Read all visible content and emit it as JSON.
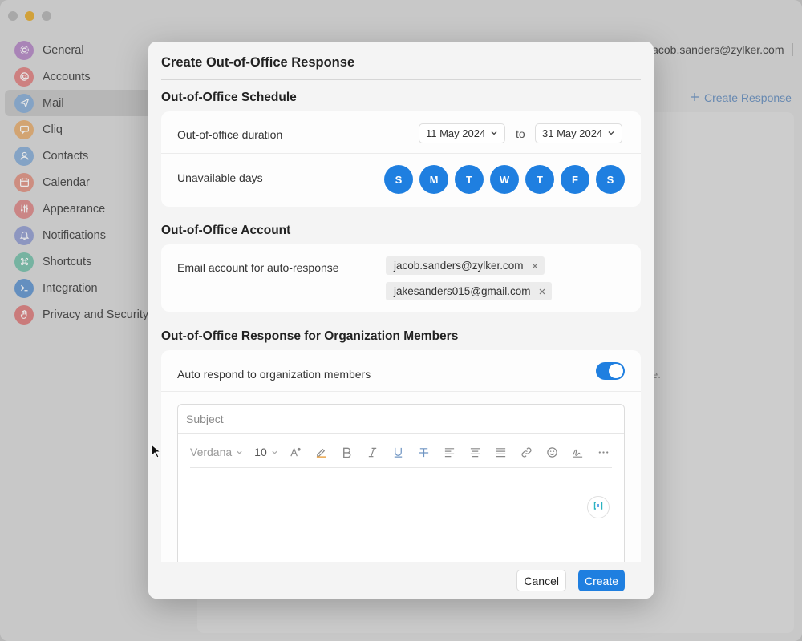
{
  "sidebar": {
    "items": [
      {
        "label": "General",
        "icon": "gear-icon",
        "color": "#b98fc9"
      },
      {
        "label": "Accounts",
        "icon": "at-icon",
        "color": "#e28a8a"
      },
      {
        "label": "Mail",
        "icon": "send-icon",
        "color": "#8fb2d9",
        "active": true
      },
      {
        "label": "Cliq",
        "icon": "chat-icon",
        "color": "#e7b37a"
      },
      {
        "label": "Contacts",
        "icon": "contact-icon",
        "color": "#8fb2d9"
      },
      {
        "label": "Calendar",
        "icon": "calendar-icon",
        "color": "#e2998a"
      },
      {
        "label": "Appearance",
        "icon": "sliders-icon",
        "color": "#de9090"
      },
      {
        "label": "Notifications",
        "icon": "bell-icon",
        "color": "#99a3d3"
      },
      {
        "label": "Shortcuts",
        "icon": "command-icon",
        "color": "#7fc4b0"
      },
      {
        "label": "Integration",
        "icon": "terminal-icon",
        "color": "#6a9bd2"
      },
      {
        "label": "Privacy and Security",
        "icon": "hand-icon",
        "color": "#de8585"
      }
    ]
  },
  "header": {
    "account_email": "jacob.sanders@zylker.com",
    "create_response": "Create Response"
  },
  "background": {
    "trailing_text": "e."
  },
  "modal": {
    "title": "Create Out-of-Office Response",
    "schedule": {
      "title": "Out-of-Office Schedule",
      "duration_label": "Out-of-office duration",
      "start_date": "11 May 2024",
      "to_label": "to",
      "end_date": "31 May 2024",
      "unavailable_label": "Unavailable days",
      "days": [
        "S",
        "M",
        "T",
        "W",
        "T",
        "F",
        "S"
      ]
    },
    "account": {
      "title": "Out-of-Office Account",
      "email_label": "Email account for auto-response",
      "emails": [
        "jacob.sanders@zylker.com",
        "jakesanders015@gmail.com"
      ]
    },
    "org": {
      "title": "Out-of-Office Response for Organization Members",
      "auto_respond_label": "Auto respond to organization members",
      "auto_respond_on": true,
      "subject_placeholder": "Subject",
      "font_family": "Verdana",
      "font_size": "10"
    },
    "footer": {
      "cancel": "Cancel",
      "create": "Create"
    }
  },
  "colors": {
    "accent": "#1f7fe0"
  }
}
